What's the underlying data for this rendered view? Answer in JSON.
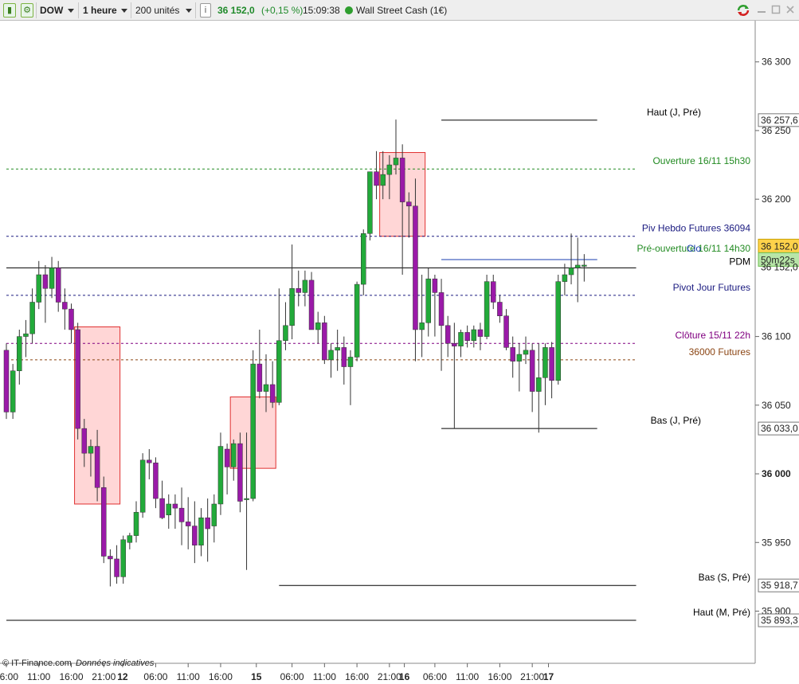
{
  "toolbar": {
    "symbol": "DOW",
    "timeframe": "1 heure",
    "units": "200 unités",
    "price": "36 152,0",
    "change": "(+0,15 %)",
    "time": "15:09:38",
    "instrument": "Wall Street Cash (1€)",
    "bar_icon": "bars-icon",
    "chart_icon": "chart-icon",
    "info_icon": "info-icon",
    "status_color": "#2e9e2e",
    "refresh_icon": "refresh-icon"
  },
  "footer": {
    "copyright": "© IT-Finance.com",
    "note": "Données indicatives"
  },
  "chart_data": {
    "type": "candlestick",
    "ylim": [
      35862,
      36330
    ],
    "y_ticks": [
      {
        "value": 36300,
        "label": "36 300"
      },
      {
        "value": 36250,
        "label": "36 250"
      },
      {
        "value": 36200,
        "label": "36 200"
      },
      {
        "value": 36100,
        "label": "36 100"
      },
      {
        "value": 36050,
        "label": "36 050"
      },
      {
        "value": 36000,
        "label": "36 000",
        "bold": true
      },
      {
        "value": 35950,
        "label": "35 950"
      },
      {
        "value": 35900,
        "label": "35 900"
      }
    ],
    "x_ticks": [
      {
        "index": 0,
        "label": "06:00"
      },
      {
        "index": 5,
        "label": "11:00"
      },
      {
        "index": 10,
        "label": "16:00"
      },
      {
        "index": 15,
        "label": "21:00"
      },
      {
        "index": 17.9,
        "label": "12",
        "bold": true
      },
      {
        "index": 23,
        "label": "06:00"
      },
      {
        "index": 28,
        "label": "11:00"
      },
      {
        "index": 33,
        "label": "16:00"
      },
      {
        "index": 38.5,
        "label": "15",
        "bold": true
      },
      {
        "index": 44,
        "label": "06:00"
      },
      {
        "index": 49,
        "label": "11:00"
      },
      {
        "index": 54,
        "label": "16:00"
      },
      {
        "index": 59,
        "label": "21:00"
      },
      {
        "index": 61.3,
        "label": "16",
        "bold": true
      },
      {
        "index": 66,
        "label": "06:00"
      },
      {
        "index": 71,
        "label": "11:00"
      },
      {
        "index": 76,
        "label": "16:00"
      },
      {
        "index": 81,
        "label": "21:00"
      },
      {
        "index": 83.5,
        "label": "17",
        "bold": true
      }
    ],
    "candles": [
      [
        36090,
        36095,
        36040,
        36045
      ],
      [
        36045,
        36080,
        36040,
        36075
      ],
      [
        36075,
        36105,
        36065,
        36100
      ],
      [
        36100,
        36112,
        36085,
        36102
      ],
      [
        36102,
        36135,
        36095,
        36125
      ],
      [
        36125,
        36155,
        36120,
        36145
      ],
      [
        36145,
        36152,
        36110,
        36135
      ],
      [
        36135,
        36158,
        36128,
        36150
      ],
      [
        36150,
        36155,
        36118,
        36125
      ],
      [
        36125,
        36135,
        36105,
        36120
      ],
      [
        36120,
        36124,
        36095,
        36105
      ],
      [
        36105,
        36110,
        36025,
        36033
      ],
      [
        36033,
        36040,
        36005,
        36015
      ],
      [
        36015,
        36025,
        35998,
        36020
      ],
      [
        36020,
        36032,
        35980,
        35990
      ],
      [
        35990,
        35998,
        35935,
        35940
      ],
      [
        35940,
        35945,
        35918,
        35938
      ],
      [
        35938,
        35948,
        35920,
        35925
      ],
      [
        35925,
        35955,
        35920,
        35952
      ],
      [
        35950,
        35957,
        35945,
        35955
      ],
      [
        35955,
        35980,
        35950,
        35972
      ],
      [
        35972,
        36015,
        35968,
        36010
      ],
      [
        36010,
        36018,
        35996,
        36008
      ],
      [
        36008,
        36012,
        35975,
        35982
      ],
      [
        35982,
        35995,
        35967,
        35968
      ],
      [
        35970,
        35985,
        35960,
        35978
      ],
      [
        35978,
        35985,
        35960,
        35975
      ],
      [
        35975,
        35990,
        35948,
        35965
      ],
      [
        35965,
        35983,
        35945,
        35962
      ],
      [
        35962,
        35980,
        35935,
        35948
      ],
      [
        35948,
        35975,
        35940,
        35968
      ],
      [
        35968,
        35982,
        35936,
        35960
      ],
      [
        35962,
        35985,
        35950,
        35978
      ],
      [
        35978,
        36030,
        35970,
        36020
      ],
      [
        36018,
        36022,
        35985,
        36005
      ],
      [
        36005,
        36025,
        35995,
        36022
      ],
      [
        36022,
        36030,
        35972,
        35980
      ],
      [
        35982,
        36030,
        35930,
        35982
      ],
      [
        35982,
        36090,
        35980,
        36080
      ],
      [
        36080,
        36105,
        36055,
        36060
      ],
      [
        36060,
        36087,
        36045,
        36065
      ],
      [
        36065,
        36082,
        36048,
        36052
      ],
      [
        36052,
        36135,
        36050,
        36097
      ],
      [
        36097,
        36125,
        36090,
        36108
      ],
      [
        36108,
        36167,
        36098,
        36135
      ],
      [
        36135,
        36148,
        36122,
        36132
      ],
      [
        36132,
        36148,
        36122,
        36141
      ],
      [
        36141,
        36147,
        36105,
        36105
      ],
      [
        36105,
        36118,
        36095,
        36110
      ],
      [
        36110,
        36115,
        36080,
        36083
      ],
      [
        36083,
        36095,
        36070,
        36090
      ],
      [
        36090,
        36105,
        36075,
        36092
      ],
      [
        36092,
        36100,
        36065,
        36078
      ],
      [
        36078,
        36090,
        36050,
        36085
      ],
      [
        36085,
        36140,
        36082,
        36138
      ],
      [
        36138,
        36178,
        36130,
        36175
      ],
      [
        36175,
        36215,
        36170,
        36220
      ],
      [
        36220,
        36235,
        36200,
        36210
      ],
      [
        36210,
        36235,
        36200,
        36218
      ],
      [
        36218,
        36232,
        36200,
        36225
      ],
      [
        36225,
        36258,
        36218,
        36230
      ],
      [
        36230,
        36240,
        36145,
        36198
      ],
      [
        36198,
        36205,
        36172,
        36195
      ],
      [
        36195,
        36215,
        36082,
        36105
      ],
      [
        36105,
        36145,
        36085,
        36110
      ],
      [
        36110,
        36150,
        36100,
        36142
      ],
      [
        36142,
        36145,
        36100,
        36132
      ],
      [
        36132,
        36142,
        36075,
        36108
      ],
      [
        36108,
        36115,
        36085,
        36095
      ],
      [
        36095,
        36110,
        36033,
        36093
      ],
      [
        36093,
        36105,
        36085,
        36103
      ],
      [
        36103,
        36108,
        36092,
        36097
      ],
      [
        36097,
        36108,
        36092,
        36105
      ],
      [
        36105,
        36110,
        36090,
        36100
      ],
      [
        36100,
        36145,
        36098,
        36140
      ],
      [
        36140,
        36145,
        36120,
        36125
      ],
      [
        36125,
        36130,
        36110,
        36115
      ],
      [
        36115,
        36120,
        36090,
        36092
      ],
      [
        36092,
        36100,
        36070,
        36082
      ],
      [
        36082,
        36095,
        36060,
        36087
      ],
      [
        36087,
        36100,
        36080,
        36090
      ],
      [
        36090,
        36095,
        36045,
        36060
      ],
      [
        36060,
        36095,
        36030,
        36070
      ],
      [
        36070,
        36095,
        36050,
        36092
      ],
      [
        36092,
        36096,
        36055,
        36068
      ],
      [
        36068,
        36145,
        36065,
        36140
      ],
      [
        36140,
        36153,
        36130,
        36145
      ],
      [
        36145,
        36175,
        36138,
        36150
      ],
      [
        36150,
        36172,
        36125,
        36152
      ],
      [
        36152,
        36160,
        36140,
        36152
      ]
    ],
    "zones": [
      {
        "from_index": 10.5,
        "to_index": 17.5,
        "top": 36107,
        "bottom": 35978
      },
      {
        "from_index": 34.5,
        "to_index": 41.5,
        "top": 36056,
        "bottom": 36004
      },
      {
        "from_index": 57.5,
        "to_index": 64.5,
        "top": 36234,
        "bottom": 36173
      }
    ],
    "levels": [
      {
        "label": "Haut (J, Pré)",
        "value": 36257.6,
        "color": "#000000",
        "style": "solid",
        "tag": "36 257,6",
        "from_index": 67,
        "to_index": 91,
        "label_pos": "left"
      },
      {
        "label": "Ouverture 16/11 15h30",
        "value": 36222,
        "color": "#228b22",
        "style": "dash",
        "tag": "",
        "from_index": 0,
        "to_index": 97
      },
      {
        "label": "Piv Hebdo Futures 36094",
        "value": 36173,
        "color": "#1a1a80",
        "style": "dash",
        "tag": "",
        "from_index": 0,
        "to_index": 97
      },
      {
        "label": "Pré-ouverture 16/11 14h30",
        "value": 36156,
        "color": "#228b22",
        "style": "solid",
        "tag": "",
        "from_index": 67,
        "to_index": 91
      },
      {
        "label": "Clo",
        "value": 36156,
        "color": "#1a3cb0",
        "style": "solid",
        "tag": "",
        "from_index": 67,
        "to_index": 91
      },
      {
        "label": "PDM",
        "value": 36150,
        "color": "#000000",
        "style": "solid",
        "tag": "36 152,0",
        "from_index": 0,
        "to_index": 97
      },
      {
        "label": "Pivot Jour Futures",
        "value": 36130,
        "color": "#1a1a80",
        "style": "dash",
        "tag": "",
        "from_index": 0,
        "to_index": 97
      },
      {
        "label": "Clôture 15/11 22h",
        "value": 36095,
        "color": "#800080",
        "style": "dash",
        "tag": "",
        "from_index": 0,
        "to_index": 97
      },
      {
        "label": "36000 Futures",
        "value": 36083,
        "color": "#8b4513",
        "style": "dash",
        "tag": "",
        "from_index": 0,
        "to_index": 97
      },
      {
        "label": "Bas (J, Pré)",
        "value": 36033,
        "color": "#000000",
        "style": "solid",
        "tag": "36 033,0",
        "from_index": 67,
        "to_index": 91
      },
      {
        "label": "Bas (S, Pré)",
        "value": 35918.7,
        "color": "#000000",
        "style": "solid",
        "tag": "35 918,7",
        "from_index": 42,
        "to_index": 97
      },
      {
        "label": "Haut (M, Pré)",
        "value": 35893.3,
        "color": "#000000",
        "style": "solid",
        "tag": "35 893,3",
        "from_index": 0,
        "to_index": 97
      }
    ],
    "price_tag": {
      "value": "36 152,0",
      "timer": "50m22s",
      "hidden": "36 152,0"
    },
    "colors": {
      "up": "#22aa3a",
      "down": "#9a1aa8",
      "zone_fill": "#ffd6d6",
      "zone_stroke": "#e03030"
    }
  }
}
